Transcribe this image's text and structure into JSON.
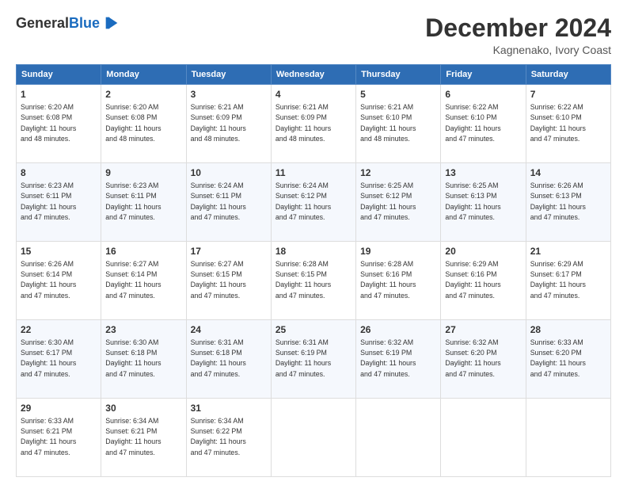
{
  "header": {
    "logo_general": "General",
    "logo_blue": "Blue",
    "main_title": "December 2024",
    "subtitle": "Kagnenako, Ivory Coast"
  },
  "calendar": {
    "days_of_week": [
      "Sunday",
      "Monday",
      "Tuesday",
      "Wednesday",
      "Thursday",
      "Friday",
      "Saturday"
    ],
    "weeks": [
      [
        {
          "day": "1",
          "sunrise": "6:20 AM",
          "sunset": "6:08 PM",
          "daylight": "11 hours and 48 minutes."
        },
        {
          "day": "2",
          "sunrise": "6:20 AM",
          "sunset": "6:08 PM",
          "daylight": "11 hours and 48 minutes."
        },
        {
          "day": "3",
          "sunrise": "6:21 AM",
          "sunset": "6:09 PM",
          "daylight": "11 hours and 48 minutes."
        },
        {
          "day": "4",
          "sunrise": "6:21 AM",
          "sunset": "6:09 PM",
          "daylight": "11 hours and 48 minutes."
        },
        {
          "day": "5",
          "sunrise": "6:21 AM",
          "sunset": "6:10 PM",
          "daylight": "11 hours and 48 minutes."
        },
        {
          "day": "6",
          "sunrise": "6:22 AM",
          "sunset": "6:10 PM",
          "daylight": "11 hours and 47 minutes."
        },
        {
          "day": "7",
          "sunrise": "6:22 AM",
          "sunset": "6:10 PM",
          "daylight": "11 hours and 47 minutes."
        }
      ],
      [
        {
          "day": "8",
          "sunrise": "6:23 AM",
          "sunset": "6:11 PM",
          "daylight": "11 hours and 47 minutes."
        },
        {
          "day": "9",
          "sunrise": "6:23 AM",
          "sunset": "6:11 PM",
          "daylight": "11 hours and 47 minutes."
        },
        {
          "day": "10",
          "sunrise": "6:24 AM",
          "sunset": "6:11 PM",
          "daylight": "11 hours and 47 minutes."
        },
        {
          "day": "11",
          "sunrise": "6:24 AM",
          "sunset": "6:12 PM",
          "daylight": "11 hours and 47 minutes."
        },
        {
          "day": "12",
          "sunrise": "6:25 AM",
          "sunset": "6:12 PM",
          "daylight": "11 hours and 47 minutes."
        },
        {
          "day": "13",
          "sunrise": "6:25 AM",
          "sunset": "6:13 PM",
          "daylight": "11 hours and 47 minutes."
        },
        {
          "day": "14",
          "sunrise": "6:26 AM",
          "sunset": "6:13 PM",
          "daylight": "11 hours and 47 minutes."
        }
      ],
      [
        {
          "day": "15",
          "sunrise": "6:26 AM",
          "sunset": "6:14 PM",
          "daylight": "11 hours and 47 minutes."
        },
        {
          "day": "16",
          "sunrise": "6:27 AM",
          "sunset": "6:14 PM",
          "daylight": "11 hours and 47 minutes."
        },
        {
          "day": "17",
          "sunrise": "6:27 AM",
          "sunset": "6:15 PM",
          "daylight": "11 hours and 47 minutes."
        },
        {
          "day": "18",
          "sunrise": "6:28 AM",
          "sunset": "6:15 PM",
          "daylight": "11 hours and 47 minutes."
        },
        {
          "day": "19",
          "sunrise": "6:28 AM",
          "sunset": "6:16 PM",
          "daylight": "11 hours and 47 minutes."
        },
        {
          "day": "20",
          "sunrise": "6:29 AM",
          "sunset": "6:16 PM",
          "daylight": "11 hours and 47 minutes."
        },
        {
          "day": "21",
          "sunrise": "6:29 AM",
          "sunset": "6:17 PM",
          "daylight": "11 hours and 47 minutes."
        }
      ],
      [
        {
          "day": "22",
          "sunrise": "6:30 AM",
          "sunset": "6:17 PM",
          "daylight": "11 hours and 47 minutes."
        },
        {
          "day": "23",
          "sunrise": "6:30 AM",
          "sunset": "6:18 PM",
          "daylight": "11 hours and 47 minutes."
        },
        {
          "day": "24",
          "sunrise": "6:31 AM",
          "sunset": "6:18 PM",
          "daylight": "11 hours and 47 minutes."
        },
        {
          "day": "25",
          "sunrise": "6:31 AM",
          "sunset": "6:19 PM",
          "daylight": "11 hours and 47 minutes."
        },
        {
          "day": "26",
          "sunrise": "6:32 AM",
          "sunset": "6:19 PM",
          "daylight": "11 hours and 47 minutes."
        },
        {
          "day": "27",
          "sunrise": "6:32 AM",
          "sunset": "6:20 PM",
          "daylight": "11 hours and 47 minutes."
        },
        {
          "day": "28",
          "sunrise": "6:33 AM",
          "sunset": "6:20 PM",
          "daylight": "11 hours and 47 minutes."
        }
      ],
      [
        {
          "day": "29",
          "sunrise": "6:33 AM",
          "sunset": "6:21 PM",
          "daylight": "11 hours and 47 minutes."
        },
        {
          "day": "30",
          "sunrise": "6:34 AM",
          "sunset": "6:21 PM",
          "daylight": "11 hours and 47 minutes."
        },
        {
          "day": "31",
          "sunrise": "6:34 AM",
          "sunset": "6:22 PM",
          "daylight": "11 hours and 47 minutes."
        },
        null,
        null,
        null,
        null
      ]
    ]
  }
}
